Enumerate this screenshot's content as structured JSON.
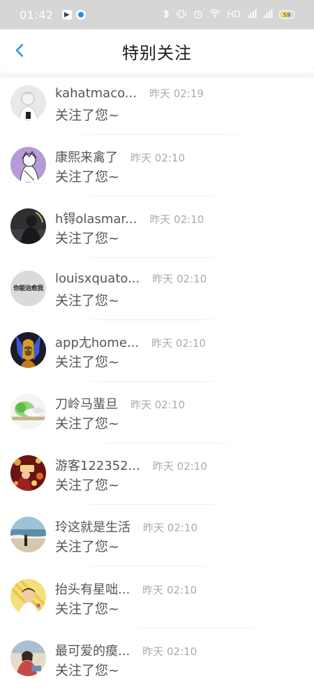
{
  "status_bar": {
    "time": "01:42",
    "network_label": "HD",
    "battery_level": "59",
    "battery_percent": 59,
    "icons": [
      "app-notification-icon",
      "browser-icon",
      "bluetooth-icon",
      "vibrate-icon",
      "alarm-icon",
      "wifi-icon",
      "signal-icon",
      "signal-4g-icon",
      "battery-icon"
    ]
  },
  "header": {
    "title": "特别关注",
    "back_icon": "chevron-left-icon",
    "accent_color": "#2a8be8"
  },
  "notifications": [
    {
      "name": "kahatmaco...",
      "time": "昨天 02:19",
      "message": "关注了您~"
    },
    {
      "name": "康熙来禽了",
      "time": "昨天 02:10",
      "message": "关注了您~"
    },
    {
      "name": "h锝olasmar...",
      "time": "昨天 02:10",
      "message": "关注了您~"
    },
    {
      "name": "louisxquato...",
      "time": "昨天 02:10",
      "message": "关注了您~",
      "avatar_text": "你能治愈我"
    },
    {
      "name": "app尢home...",
      "time": "昨天 02:10",
      "message": "关注了您~"
    },
    {
      "name": "刀岭马蜚旦",
      "time": "昨天 02:10",
      "message": "关注了您~"
    },
    {
      "name": "游客122352...",
      "time": "昨天 02:10",
      "message": "关注了您~"
    },
    {
      "name": "玲这就是生活",
      "time": "昨天 02:10",
      "message": "关注了您~"
    },
    {
      "name": "抬头有星咄...",
      "time": "昨天 02:10",
      "message": "关注了您~"
    },
    {
      "name": "最可爱的瘼...",
      "time": "昨天 02:10",
      "message": "关注了您~"
    }
  ]
}
